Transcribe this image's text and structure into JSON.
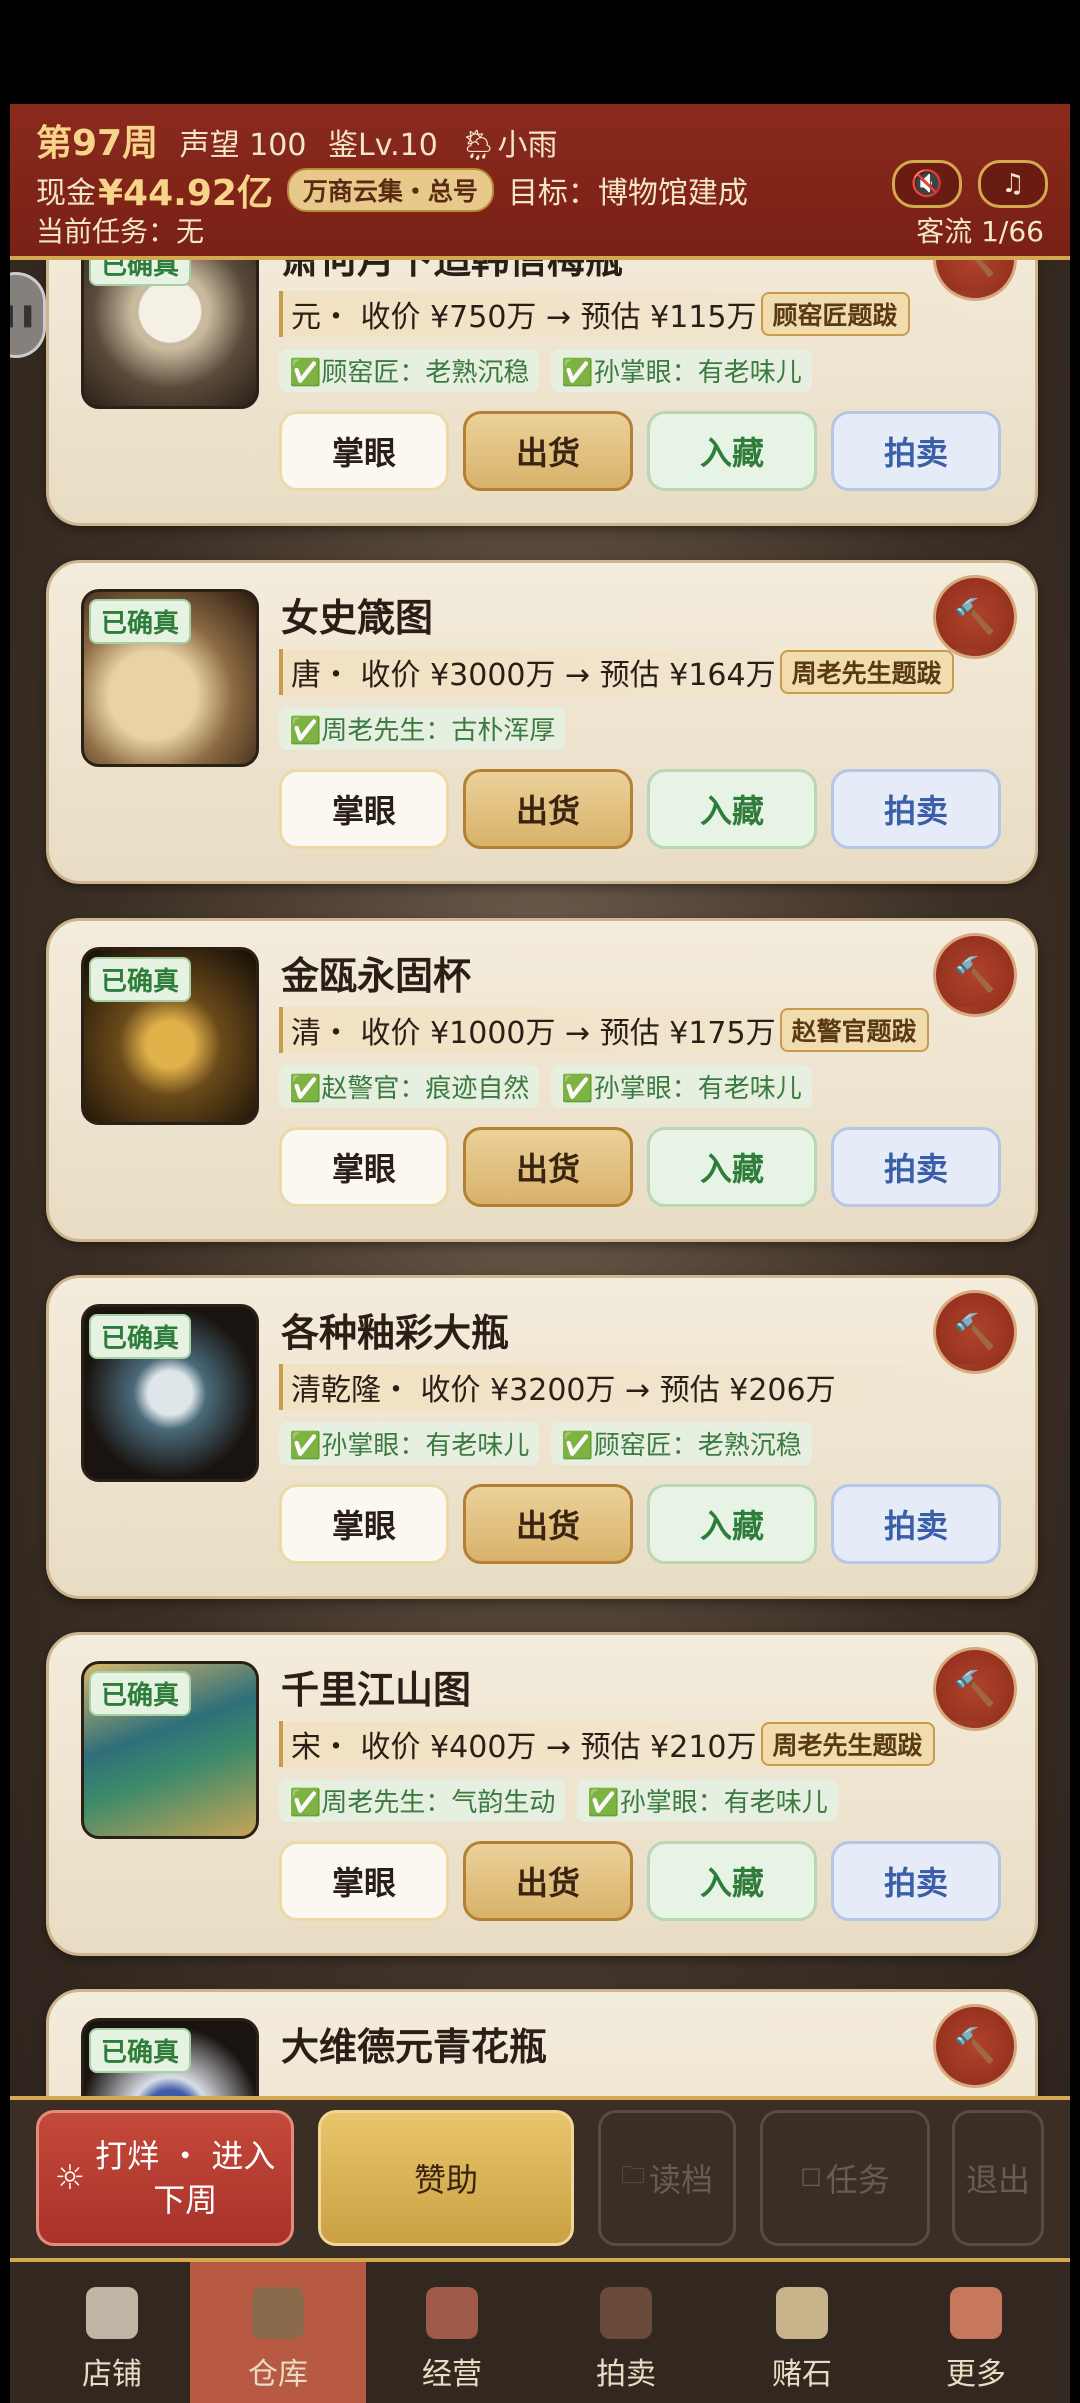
{
  "header": {
    "week": "第97周",
    "reputation": "声望 100",
    "level": "鉴Lv.10",
    "weather": "小雨",
    "cash_label": "现金",
    "cash": "¥44.92亿",
    "tag": "万商云集・总号",
    "goal": "目标：博物馆建成",
    "task": "当前任务：无",
    "flow": "客流 1/66"
  },
  "cards": [
    {
      "title": "萧何月下追韩信梅瓶",
      "dynasty": "元",
      "price_text": " ・ 收价 ¥750万 → 预估 ¥115万",
      "tag": "顾窑匠题跋",
      "comments": [
        "✅顾窑匠：老熟沉稳",
        "✅孙掌眼：有老味儿"
      ]
    },
    {
      "title": "女史箴图",
      "dynasty": "唐",
      "price_text": " ・ 收价 ¥3000万 → 预估 ¥164万",
      "tag": "周老先生题跋",
      "comments": [
        "✅周老先生：古朴浑厚"
      ]
    },
    {
      "title": "金瓯永固杯",
      "dynasty": "清",
      "price_text": " ・ 收价 ¥1000万 → 预估 ¥175万",
      "tag": "赵警官题跋",
      "comments": [
        "✅赵警官：痕迹自然",
        "✅孙掌眼：有老味儿"
      ]
    },
    {
      "title": "各种釉彩大瓶",
      "dynasty": "清乾隆",
      "price_text": " ・ 收价 ¥3200万 → 预估 ¥206万",
      "tag": "",
      "comments": [
        "✅孙掌眼：有老味儿",
        "✅顾窑匠：老熟沉稳"
      ]
    },
    {
      "title": "千里江山图",
      "dynasty": "宋",
      "price_text": " ・ 收价 ¥400万 → 预估 ¥210万",
      "tag": "周老先生题跋",
      "comments": [
        "✅周老先生：气韵生动",
        "✅孙掌眼：有老味儿"
      ]
    },
    {
      "title": "大维德元青花瓶",
      "dynasty": "",
      "price_text": "",
      "tag": "",
      "comments": []
    }
  ],
  "badge_label": "已确真",
  "buttons": {
    "inspect": "掌眼",
    "sell": "出货",
    "collect": "入藏",
    "auction": "拍卖"
  },
  "actions": {
    "main_line1": "打烊 ・ 进入",
    "main_line2": "下周",
    "sponsor": "赞助",
    "load": "读档",
    "task": "任务",
    "exit": "退出"
  },
  "tabs": [
    "店铺",
    "仓库",
    "经营",
    "拍卖",
    "赌石",
    "更多"
  ],
  "active_tab": "仓库"
}
